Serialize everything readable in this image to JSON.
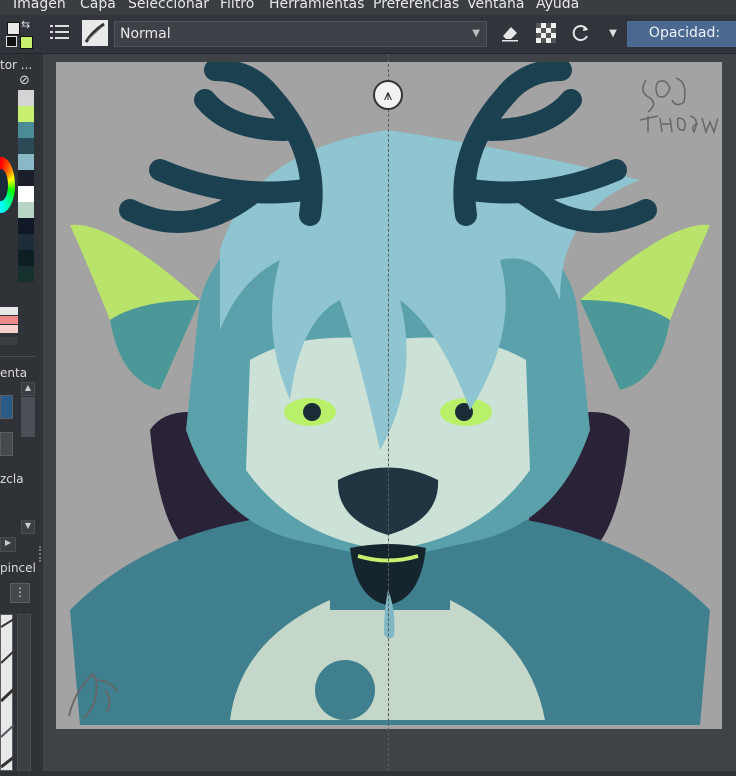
{
  "menubar": {
    "items": [
      "Imagen",
      "Capa",
      "Seleccionar",
      "Filtro",
      "Herramientas",
      "Preferencias",
      "Ventana",
      "Ayuda"
    ]
  },
  "toolbar": {
    "blend_mode": "Normal",
    "opacity_label": "Opacidad:"
  },
  "left_dock": {
    "color_panel_title": "tor ...",
    "palette_colors": [
      "#d4d4d4",
      "#c6f06e",
      "#4b8b96",
      "#2c4a55",
      "#8ab8c6",
      "#1a1f2a",
      "#ffffff",
      "#b7d4c4",
      "#101828",
      "#1e2c3a",
      "#0c1e22",
      "#16302e"
    ],
    "history_colors": [
      "#e7e7e7",
      "#f08a8a",
      "#f6cfcf"
    ],
    "tool_panel_label": "enta",
    "smudge_label": "zcla",
    "brush_panel_label": "pincel"
  },
  "canvas": {
    "signature": "SOM THOBOW",
    "background": "#a3a3a3"
  }
}
